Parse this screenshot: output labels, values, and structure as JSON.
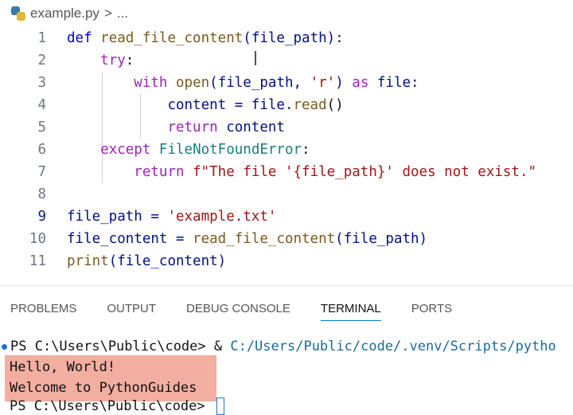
{
  "breadcrumb": {
    "file": "example.py",
    "separator": ">",
    "more": "..."
  },
  "colors": {
    "accent": "#007acc",
    "highlight": "#f2aea0"
  },
  "editor": {
    "line_numbers": [
      "1",
      "2",
      "3",
      "4",
      "5",
      "6",
      "7",
      "8",
      "9",
      "10",
      "11"
    ],
    "code": {
      "l1_def": "def",
      "l1_fn": "read_file_content",
      "l1_rest": "(file_path):",
      "l2_try": "try",
      "l2_colon": ":",
      "l3_with": "with",
      "l3_open": "open",
      "l3_a": "(file_path, ",
      "l3_str": "'r'",
      "l3_b": ") ",
      "l3_as": "as",
      "l3_c": " file:",
      "l4_a": "content = file.",
      "l4_fn": "read",
      "l4_b": "()",
      "l5_ret": "return",
      "l5_b": " content",
      "l6_exc": "except",
      "l6_cls": "FileNotFoundError",
      "l6_colon": ":",
      "l7_ret": "return",
      "l7_str": "f\"The file '{file_path}' does not exist.\"",
      "l9_a": "file_path = ",
      "l9_str": "'example.txt'",
      "l10_a": "file_content = ",
      "l10_fn": "read_file_content",
      "l10_b": "(file_path)",
      "l11_fn": "print",
      "l11_b": "(file_content)"
    }
  },
  "panel": {
    "tabs": [
      "PROBLEMS",
      "OUTPUT",
      "DEBUG CONSOLE",
      "TERMINAL",
      "PORTS"
    ],
    "active_tab": "TERMINAL"
  },
  "terminal": {
    "prompt1": "PS C:\\Users\\Public\\code> & ",
    "cmd_path": "C:/Users/Public/code/.venv/Scripts/pytho",
    "out1": "Hello, World!",
    "out2": "Welcome to PythonGuides",
    "prompt2": "PS C:\\Users\\Public\\code> "
  }
}
